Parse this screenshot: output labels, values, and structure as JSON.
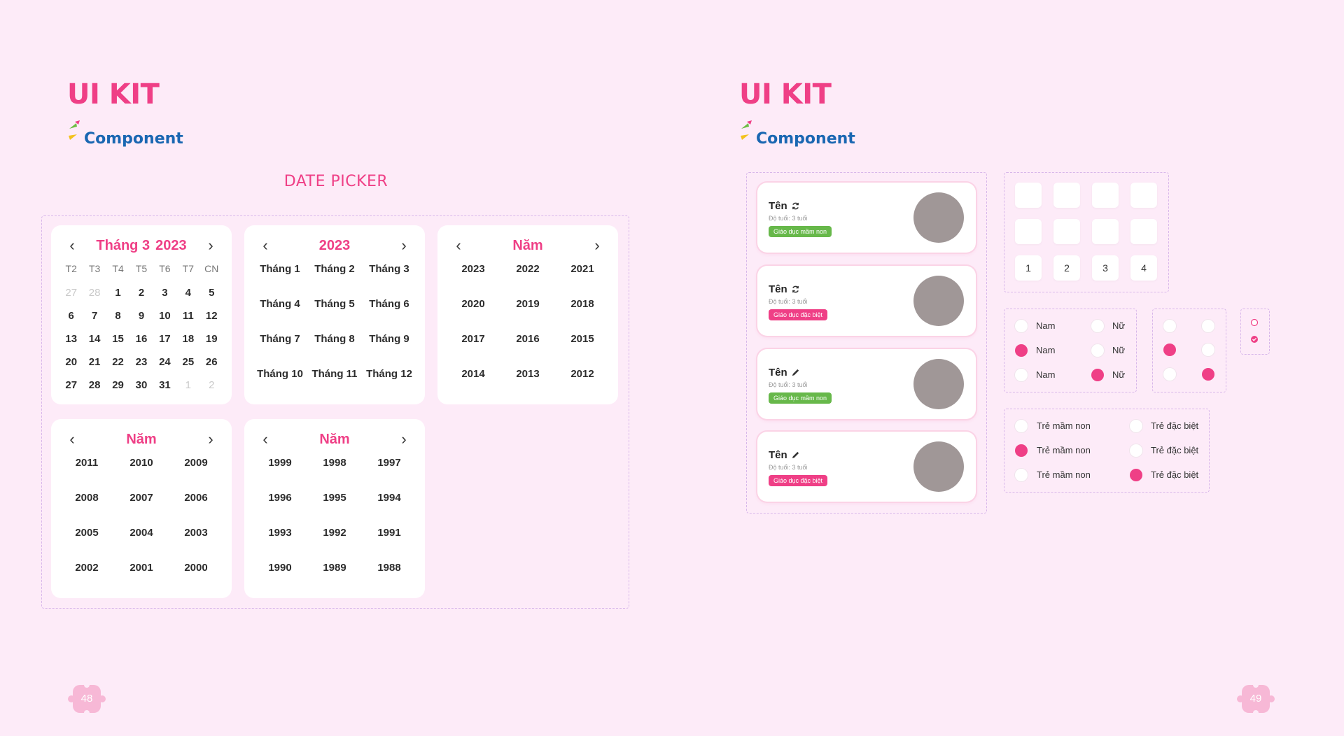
{
  "left_page": {
    "kit_title": "UI KIT",
    "component_label": "Component",
    "section_title": "DATE PICKER",
    "page_number": "48"
  },
  "right_page": {
    "kit_title": "UI KIT",
    "component_label": "Component",
    "page_number": "49"
  },
  "date_picker": {
    "day_calendar": {
      "month": "Tháng 3",
      "year": "2023",
      "weekdays": [
        "T2",
        "T3",
        "T4",
        "T5",
        "T6",
        "T7",
        "CN"
      ],
      "days": [
        [
          "27",
          "28",
          "1",
          "2",
          "3",
          "4",
          "5"
        ],
        [
          "6",
          "7",
          "8",
          "9",
          "10",
          "11",
          "12"
        ],
        [
          "13",
          "14",
          "15",
          "16",
          "17",
          "18",
          "19"
        ],
        [
          "20",
          "21",
          "22",
          "23",
          "24",
          "25",
          "26"
        ],
        [
          "27",
          "28",
          "29",
          "30",
          "31",
          "1",
          "2"
        ]
      ]
    },
    "month_calendar": {
      "title": "2023",
      "months": [
        "Tháng 1",
        "Tháng 2",
        "Tháng 3",
        "Tháng 4",
        "Tháng 5",
        "Tháng 6",
        "Tháng 7",
        "Tháng 8",
        "Tháng 9",
        "Tháng 10",
        "Tháng 11",
        "Tháng 12"
      ]
    },
    "year_calendars": [
      {
        "title": "Năm",
        "years": [
          "2023",
          "2022",
          "2021",
          "2020",
          "2019",
          "2018",
          "2017",
          "2016",
          "2015",
          "2014",
          "2013",
          "2012"
        ]
      },
      {
        "title": "Năm",
        "years": [
          "2011",
          "2010",
          "2009",
          "2008",
          "2007",
          "2006",
          "2005",
          "2004",
          "2003",
          "2002",
          "2001",
          "2000"
        ]
      },
      {
        "title": "Năm",
        "years": [
          "1999",
          "1998",
          "1997",
          "1996",
          "1995",
          "1994",
          "1993",
          "1992",
          "1991",
          "1990",
          "1989",
          "1988"
        ]
      }
    ]
  },
  "profile_cards": [
    {
      "name": "Tên",
      "action_icon": "refresh-icon",
      "age": "Độ tuổi: 3 tuổi",
      "tag": "Giáo dục mầm non",
      "tag_color": "#67b84a"
    },
    {
      "name": "Tên",
      "action_icon": "refresh-icon",
      "age": "Độ tuổi: 3 tuổi",
      "tag": "Giáo dục đặc biệt",
      "tag_color": "#ef3f86"
    },
    {
      "name": "Tên",
      "action_icon": "edit-icon",
      "age": "Độ tuổi: 3 tuổi",
      "tag": "Giáo dục mầm non",
      "tag_color": "#67b84a"
    },
    {
      "name": "Tên",
      "action_icon": "edit-icon",
      "age": "Độ tuổi: 3 tuổi",
      "tag": "Giáo dục đặc biệt",
      "tag_color": "#ef3f86"
    }
  ],
  "code_boxes": {
    "numbers": [
      "1",
      "2",
      "3",
      "4"
    ]
  },
  "gender_radios": {
    "male": "Nam",
    "female": "Nữ",
    "rows": [
      {
        "male_selected": false,
        "female_selected": false
      },
      {
        "male_selected": true,
        "female_selected": false
      },
      {
        "male_selected": false,
        "female_selected": true
      }
    ]
  },
  "child_type_radios": {
    "preschool": "Trẻ mầm non",
    "special": "Trẻ đặc biệt",
    "rows": [
      {
        "preschool_selected": false,
        "special_selected": false
      },
      {
        "preschool_selected": true,
        "special_selected": false
      },
      {
        "preschool_selected": false,
        "special_selected": true
      }
    ]
  },
  "colors": {
    "background": "#fdebf8",
    "accent_pink": "#ef3f86",
    "brand_blue": "#1a67b2",
    "tag_green": "#67b84a",
    "avatar_gray": "#a09797"
  }
}
